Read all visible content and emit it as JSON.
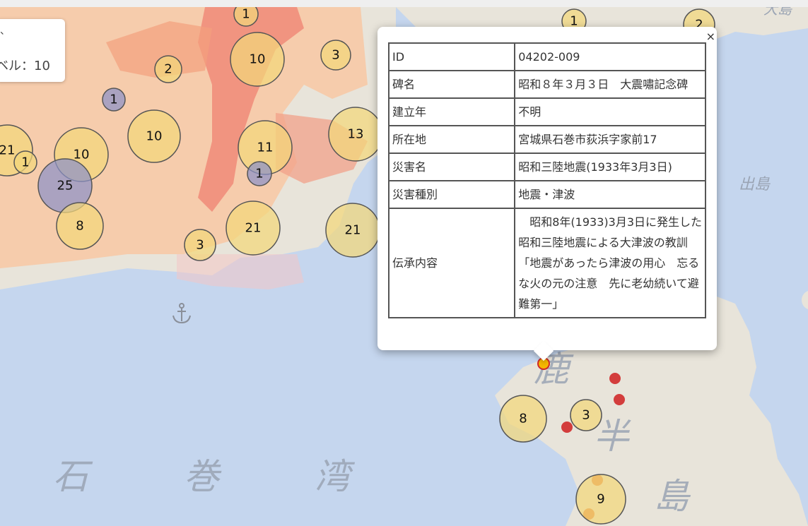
{
  "zoom_box": {
    "line1": "、",
    "line2": "ベル：10"
  },
  "popup": {
    "close": "×",
    "rows": [
      {
        "key": "ID",
        "value": "04202-009"
      },
      {
        "key": "碑名",
        "value": "昭和８年３月３日　大震嘯記念碑"
      },
      {
        "key": "建立年",
        "value": "不明"
      },
      {
        "key": "所在地",
        "value": "宮城県石巻市荻浜字家前17"
      },
      {
        "key": "災害名",
        "value": "昭和三陸地震(1933年3月3日)"
      },
      {
        "key": "災害種別",
        "value": "地震・津波"
      },
      {
        "key": "伝承内容",
        "value": "　昭和8年(1933)3月3日に発生した昭和三陸地震による大津波の教訓「地震があったら津波の用心　忘るな火の元の注意　先に老幼続いて避難第一」"
      }
    ]
  },
  "map_labels": {
    "bay_1": "石",
    "bay_2": "巻",
    "bay_3": "湾",
    "pen_1": "鹿",
    "pen_2": "半",
    "pen_3": "島",
    "island": "出島",
    "corner": "大島"
  },
  "clusters": [
    {
      "count": "1",
      "color": "yellow"
    },
    {
      "count": "10",
      "color": "yellow"
    },
    {
      "count": "2",
      "color": "yellow"
    },
    {
      "count": "3",
      "color": "yellow"
    },
    {
      "count": "1",
      "color": "purple"
    },
    {
      "count": "10",
      "color": "yellow"
    },
    {
      "count": "21",
      "color": "yellow"
    },
    {
      "count": "1",
      "color": "yellow"
    },
    {
      "count": "10",
      "color": "yellow"
    },
    {
      "count": "25",
      "color": "purple"
    },
    {
      "count": "11",
      "color": "yellow"
    },
    {
      "count": "1",
      "color": "purple"
    },
    {
      "count": "13",
      "color": "yellow"
    },
    {
      "count": "8",
      "color": "yellow"
    },
    {
      "count": "21",
      "color": "yellow"
    },
    {
      "count": "3",
      "color": "yellow"
    },
    {
      "count": "21",
      "color": "yellow"
    },
    {
      "count": "1",
      "color": "yellow"
    },
    {
      "count": "2",
      "color": "yellow"
    },
    {
      "count": "8",
      "color": "yellow"
    },
    {
      "count": "3",
      "color": "yellow"
    },
    {
      "count": "9",
      "color": "yellow"
    }
  ],
  "colors": {
    "sea": "#c5d6ee",
    "land": "#e8e4da",
    "hazard_light": "#f7c9a6",
    "hazard_dark": "#f08a78",
    "cluster_yellow": "#f3d77a",
    "cluster_purple": "#8c92c8",
    "marker_red": "#d02a2a",
    "marker_selected": "#f5b700"
  }
}
